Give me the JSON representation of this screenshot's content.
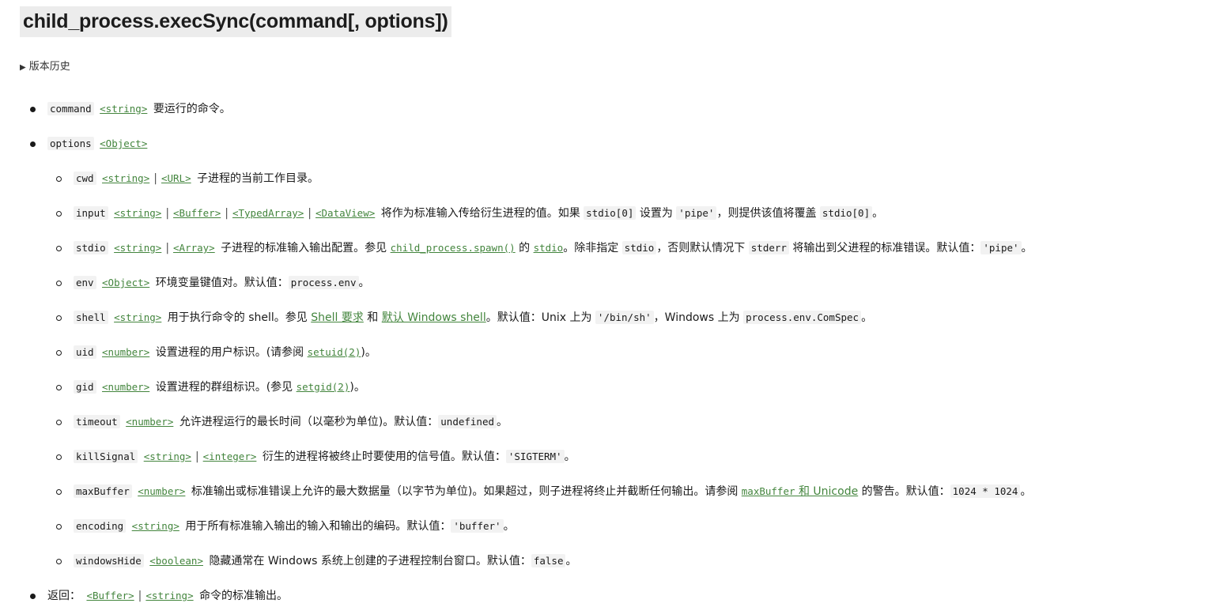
{
  "title": "child_process.execSync(command[, options])",
  "history_label": "版本历史",
  "params": {
    "command": {
      "name": "command",
      "type": "<string>",
      "desc": "要运行的命令。"
    },
    "options": {
      "name": "options",
      "type": "<Object>"
    },
    "cwd": {
      "name": "cwd",
      "type1": "<string>",
      "type2": "<URL>",
      "desc": "子进程的当前工作目录。"
    },
    "input": {
      "name": "input",
      "types": [
        "<string>",
        "<Buffer>",
        "<TypedArray>",
        "<DataView>"
      ],
      "desc1": "将作为标准输入传给衍生进程的值。如果",
      "code1": "stdio[0]",
      "desc2": "设置为",
      "code2": "'pipe'",
      "desc3": "，则提供该值将覆盖",
      "code3": "stdio[0]",
      "desc4": "。"
    },
    "stdio": {
      "name": "stdio",
      "type1": "<string>",
      "type2": "<Array>",
      "desc1": "子进程的标准输入输出配置。参见",
      "link1": "child_process.spawn()",
      "desc2": "的",
      "link2": "stdio",
      "desc3": "。除非指定",
      "code1": "stdio",
      "desc4": "，否则默认情况下",
      "code2": "stderr",
      "desc5": "将输出到父进程的标准错误。默认值：",
      "code3": "'pipe'",
      "desc6": "。"
    },
    "env": {
      "name": "env",
      "type": "<Object>",
      "desc": "环境变量键值对。默认值：",
      "code": "process.env",
      "end": "。"
    },
    "shell": {
      "name": "shell",
      "type": "<string>",
      "desc1": "用于执行命令的 shell。参见",
      "link1": "Shell 要求",
      "desc2": "和",
      "link2": "默认 Windows shell",
      "desc3": "。默认值：Unix 上为",
      "code1": "'/bin/sh'",
      "desc4": "，Windows 上为",
      "code2": "process.env.ComSpec",
      "end": "。"
    },
    "uid": {
      "name": "uid",
      "type": "<number>",
      "desc": "设置进程的用户标识。(请参阅",
      "link": "setuid(2)",
      "end": ")。"
    },
    "gid": {
      "name": "gid",
      "type": "<number>",
      "desc": "设置进程的群组标识。(参见",
      "link": "setgid(2)",
      "end": ")。"
    },
    "timeout": {
      "name": "timeout",
      "type": "<number>",
      "desc": "允许进程运行的最长时间（以毫秒为单位)。默认值：",
      "code": "undefined",
      "end": "。"
    },
    "killSignal": {
      "name": "killSignal",
      "type1": "<string>",
      "type2": "<integer>",
      "desc": "衍生的进程将被终止时要使用的信号值。默认值：",
      "code": "'SIGTERM'",
      "end": "。"
    },
    "maxBuffer": {
      "name": "maxBuffer",
      "type": "<number>",
      "desc1": "标准输出或标准错误上允许的最大数据量（以字节为单位)。如果超过，则子进程将终止并截断任何输出。请参阅",
      "link_code": "maxBuffer",
      "link_text": " 和 Unicode",
      "desc2": "的警告。默认值：",
      "code": "1024 * 1024",
      "end": "。"
    },
    "encoding": {
      "name": "encoding",
      "type": "<string>",
      "desc": "用于所有标准输入输出的输入和输出的编码。默认值：",
      "code": "'buffer'",
      "end": "。"
    },
    "windowsHide": {
      "name": "windowsHide",
      "type": "<boolean>",
      "desc": "隐藏通常在 Windows 系统上创建的子进程控制台窗口。默认值：",
      "code": "false",
      "end": "。"
    },
    "returns": {
      "label": "返回：",
      "type1": "<Buffer>",
      "type2": "<string>",
      "desc": "命令的标准输出。"
    }
  }
}
